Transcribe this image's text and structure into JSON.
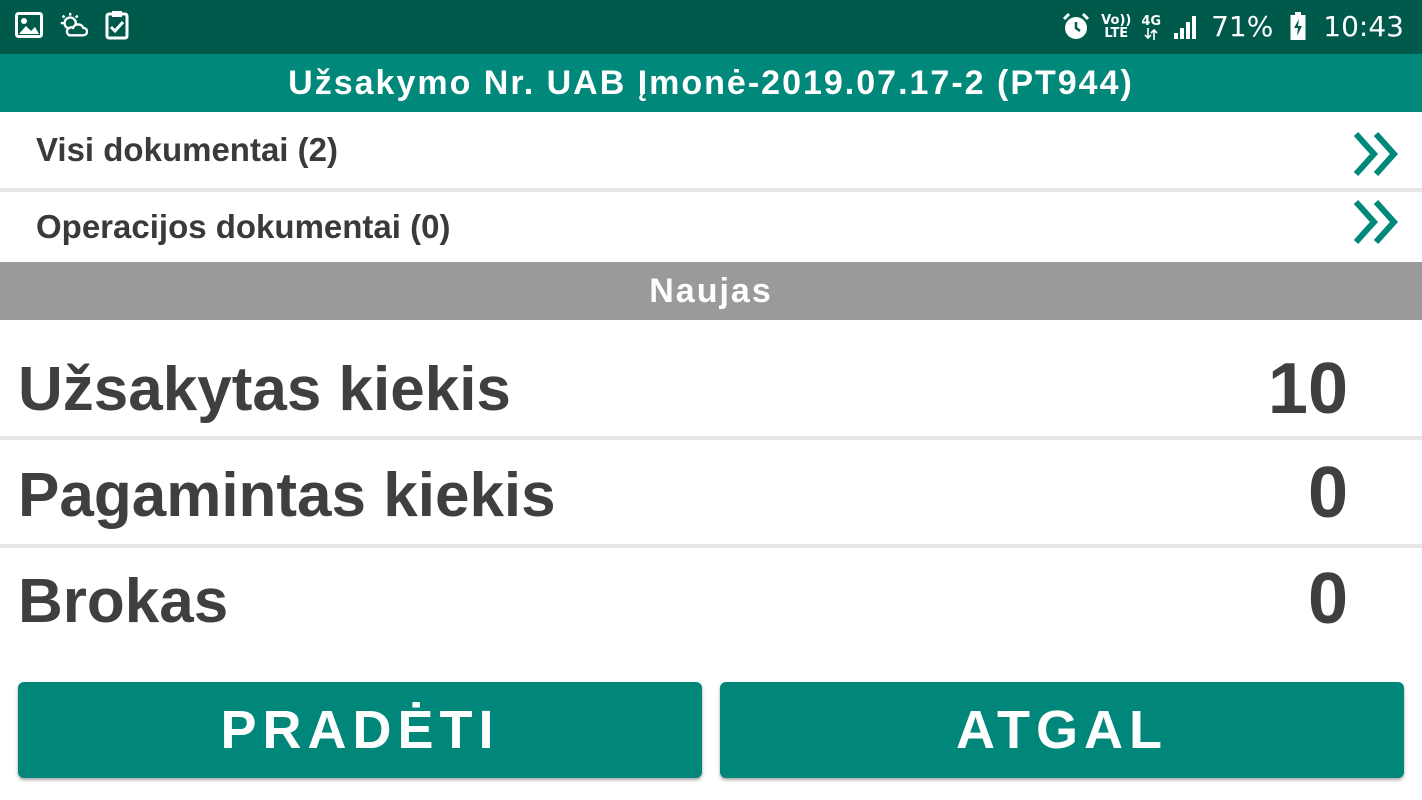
{
  "status_bar": {
    "battery_percent": "71%",
    "time": "10:43",
    "network": "4G",
    "volte_line1": "Vo))",
    "volte_line2": "LTE",
    "icons_left": [
      "image-icon",
      "weather-icon",
      "clipboard-check-icon"
    ],
    "icons_right": [
      "alarm-icon",
      "volte-icon",
      "network-4g-icon",
      "signal-icon",
      "battery-icon"
    ]
  },
  "header": {
    "title": "Užsakymo Nr. UAB Įmonė-2019.07.17-2 (PT944)"
  },
  "documents": {
    "all_label": "Visi dokumentai (2)",
    "operation_label": "Operacijos dokumentai (0)"
  },
  "order_status": "Naujas",
  "quantities": [
    {
      "label": "Užsakytas kiekis",
      "value": "10"
    },
    {
      "label": "Pagamintas kiekis",
      "value": "0"
    },
    {
      "label": "Brokas",
      "value": "0"
    }
  ],
  "buttons": {
    "start_label": "PRADĖTI",
    "back_label": "ATGAL"
  },
  "colors": {
    "status_bar": "#005a4c",
    "accent": "#00887a",
    "status_band": "#9a9a9a",
    "text": "#3f3f3f"
  }
}
